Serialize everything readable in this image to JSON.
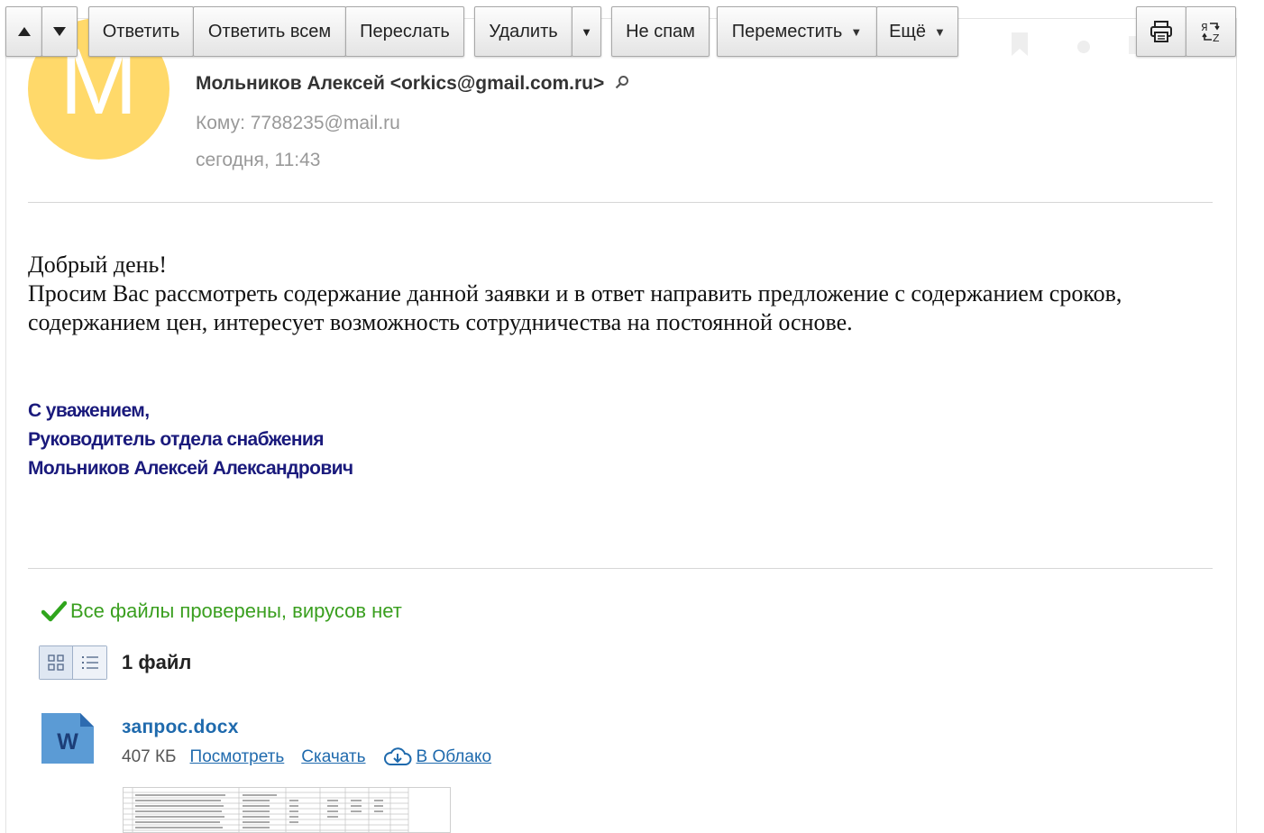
{
  "toolbar": {
    "reply": "Ответить",
    "reply_all": "Ответить всем",
    "forward": "Переслать",
    "delete": "Удалить",
    "not_spam": "Не спам",
    "move": "Переместить",
    "more": "Ещё"
  },
  "avatar": {
    "letter": "M",
    "color": "#ffd96a"
  },
  "message": {
    "sender": "Мольников Алексей <orkics@gmail.com.ru>",
    "recipient": "Кому: 7788235@mail.ru",
    "date": "сегодня, 11:43",
    "body": {
      "greeting": "Добрый день!",
      "paragraph": "Просим Вас рассмотреть содержание данной заявки и в ответ направить предложение с содержанием сроков, содержанием цен, интересует возможность сотрудничества на постоянной основе."
    },
    "signature": {
      "line1": "С уважением,",
      "line2": "Руководитель отдела снабжения",
      "line3": "Мольников Алексей Александрович"
    }
  },
  "attachments": {
    "virus_status": "Все файлы проверены, вирусов нет",
    "count_label": "1 файл",
    "files": [
      {
        "name": "запрос.docx",
        "size": "407 КБ",
        "icon_letter": "W",
        "view_label": "Посмотреть",
        "download_label": "Скачать",
        "cloud_label": "В Облако"
      }
    ]
  },
  "colors": {
    "link": "#1f6aad",
    "virus_ok": "#3a9f1f",
    "signature": "#1a1a7c",
    "doc_icon": "#5b9bd5"
  }
}
